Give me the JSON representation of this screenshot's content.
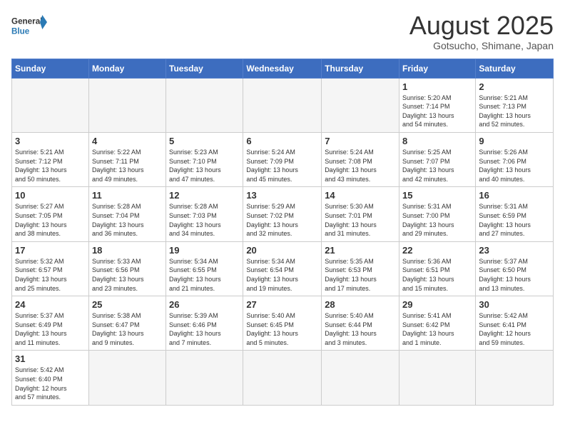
{
  "logo": {
    "text_general": "General",
    "text_blue": "Blue"
  },
  "header": {
    "month": "August 2025",
    "location": "Gotsucho, Shimane, Japan"
  },
  "weekdays": [
    "Sunday",
    "Monday",
    "Tuesday",
    "Wednesday",
    "Thursday",
    "Friday",
    "Saturday"
  ],
  "weeks": [
    [
      {
        "day": "",
        "info": ""
      },
      {
        "day": "",
        "info": ""
      },
      {
        "day": "",
        "info": ""
      },
      {
        "day": "",
        "info": ""
      },
      {
        "day": "",
        "info": ""
      },
      {
        "day": "1",
        "info": "Sunrise: 5:20 AM\nSunset: 7:14 PM\nDaylight: 13 hours\nand 54 minutes."
      },
      {
        "day": "2",
        "info": "Sunrise: 5:21 AM\nSunset: 7:13 PM\nDaylight: 13 hours\nand 52 minutes."
      }
    ],
    [
      {
        "day": "3",
        "info": "Sunrise: 5:21 AM\nSunset: 7:12 PM\nDaylight: 13 hours\nand 50 minutes."
      },
      {
        "day": "4",
        "info": "Sunrise: 5:22 AM\nSunset: 7:11 PM\nDaylight: 13 hours\nand 49 minutes."
      },
      {
        "day": "5",
        "info": "Sunrise: 5:23 AM\nSunset: 7:10 PM\nDaylight: 13 hours\nand 47 minutes."
      },
      {
        "day": "6",
        "info": "Sunrise: 5:24 AM\nSunset: 7:09 PM\nDaylight: 13 hours\nand 45 minutes."
      },
      {
        "day": "7",
        "info": "Sunrise: 5:24 AM\nSunset: 7:08 PM\nDaylight: 13 hours\nand 43 minutes."
      },
      {
        "day": "8",
        "info": "Sunrise: 5:25 AM\nSunset: 7:07 PM\nDaylight: 13 hours\nand 42 minutes."
      },
      {
        "day": "9",
        "info": "Sunrise: 5:26 AM\nSunset: 7:06 PM\nDaylight: 13 hours\nand 40 minutes."
      }
    ],
    [
      {
        "day": "10",
        "info": "Sunrise: 5:27 AM\nSunset: 7:05 PM\nDaylight: 13 hours\nand 38 minutes."
      },
      {
        "day": "11",
        "info": "Sunrise: 5:28 AM\nSunset: 7:04 PM\nDaylight: 13 hours\nand 36 minutes."
      },
      {
        "day": "12",
        "info": "Sunrise: 5:28 AM\nSunset: 7:03 PM\nDaylight: 13 hours\nand 34 minutes."
      },
      {
        "day": "13",
        "info": "Sunrise: 5:29 AM\nSunset: 7:02 PM\nDaylight: 13 hours\nand 32 minutes."
      },
      {
        "day": "14",
        "info": "Sunrise: 5:30 AM\nSunset: 7:01 PM\nDaylight: 13 hours\nand 31 minutes."
      },
      {
        "day": "15",
        "info": "Sunrise: 5:31 AM\nSunset: 7:00 PM\nDaylight: 13 hours\nand 29 minutes."
      },
      {
        "day": "16",
        "info": "Sunrise: 5:31 AM\nSunset: 6:59 PM\nDaylight: 13 hours\nand 27 minutes."
      }
    ],
    [
      {
        "day": "17",
        "info": "Sunrise: 5:32 AM\nSunset: 6:57 PM\nDaylight: 13 hours\nand 25 minutes."
      },
      {
        "day": "18",
        "info": "Sunrise: 5:33 AM\nSunset: 6:56 PM\nDaylight: 13 hours\nand 23 minutes."
      },
      {
        "day": "19",
        "info": "Sunrise: 5:34 AM\nSunset: 6:55 PM\nDaylight: 13 hours\nand 21 minutes."
      },
      {
        "day": "20",
        "info": "Sunrise: 5:34 AM\nSunset: 6:54 PM\nDaylight: 13 hours\nand 19 minutes."
      },
      {
        "day": "21",
        "info": "Sunrise: 5:35 AM\nSunset: 6:53 PM\nDaylight: 13 hours\nand 17 minutes."
      },
      {
        "day": "22",
        "info": "Sunrise: 5:36 AM\nSunset: 6:51 PM\nDaylight: 13 hours\nand 15 minutes."
      },
      {
        "day": "23",
        "info": "Sunrise: 5:37 AM\nSunset: 6:50 PM\nDaylight: 13 hours\nand 13 minutes."
      }
    ],
    [
      {
        "day": "24",
        "info": "Sunrise: 5:37 AM\nSunset: 6:49 PM\nDaylight: 13 hours\nand 11 minutes."
      },
      {
        "day": "25",
        "info": "Sunrise: 5:38 AM\nSunset: 6:47 PM\nDaylight: 13 hours\nand 9 minutes."
      },
      {
        "day": "26",
        "info": "Sunrise: 5:39 AM\nSunset: 6:46 PM\nDaylight: 13 hours\nand 7 minutes."
      },
      {
        "day": "27",
        "info": "Sunrise: 5:40 AM\nSunset: 6:45 PM\nDaylight: 13 hours\nand 5 minutes."
      },
      {
        "day": "28",
        "info": "Sunrise: 5:40 AM\nSunset: 6:44 PM\nDaylight: 13 hours\nand 3 minutes."
      },
      {
        "day": "29",
        "info": "Sunrise: 5:41 AM\nSunset: 6:42 PM\nDaylight: 13 hours\nand 1 minute."
      },
      {
        "day": "30",
        "info": "Sunrise: 5:42 AM\nSunset: 6:41 PM\nDaylight: 12 hours\nand 59 minutes."
      }
    ],
    [
      {
        "day": "31",
        "info": "Sunrise: 5:42 AM\nSunset: 6:40 PM\nDaylight: 12 hours\nand 57 minutes."
      },
      {
        "day": "",
        "info": ""
      },
      {
        "day": "",
        "info": ""
      },
      {
        "day": "",
        "info": ""
      },
      {
        "day": "",
        "info": ""
      },
      {
        "day": "",
        "info": ""
      },
      {
        "day": "",
        "info": ""
      }
    ]
  ]
}
